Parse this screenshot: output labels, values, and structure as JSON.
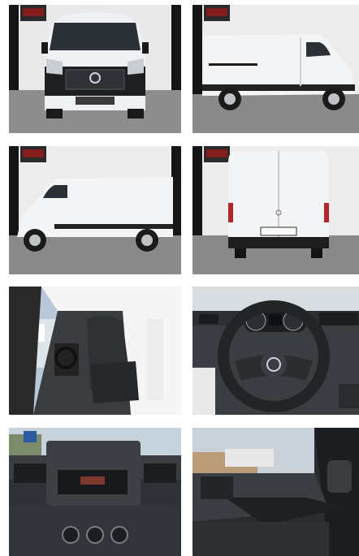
{
  "gallery": {
    "photos": [
      {
        "label": "front"
      },
      {
        "label": "side-right"
      },
      {
        "label": "side-left"
      },
      {
        "label": "rear"
      },
      {
        "label": "cabin-seats"
      },
      {
        "label": "steering-wheel"
      },
      {
        "label": "dashboard-radio"
      },
      {
        "label": "passenger-side"
      }
    ]
  },
  "colors": {
    "van_body": "#f1f2f4",
    "studio_wall": "#ececec",
    "studio_floor": "#8a8a8a",
    "dark_trim": "#1c1c1c",
    "dash_grey": "#3a3d42"
  }
}
